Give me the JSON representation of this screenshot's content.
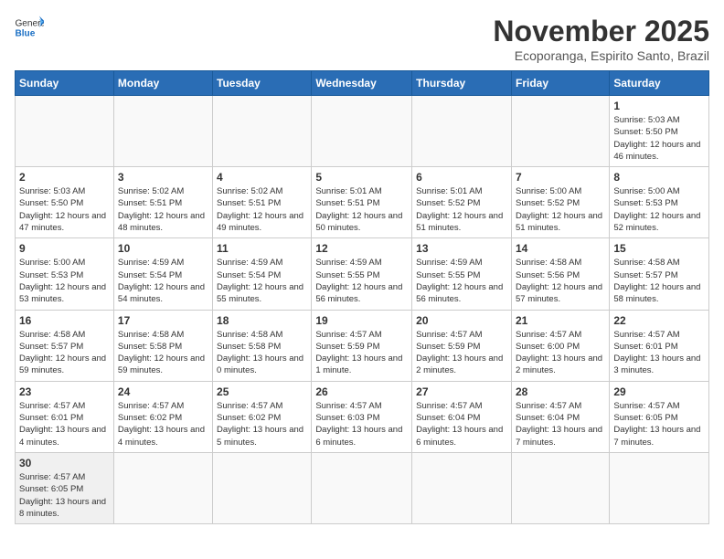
{
  "header": {
    "logo_general": "General",
    "logo_blue": "Blue",
    "month_title": "November 2025",
    "location": "Ecoporanga, Espirito Santo, Brazil"
  },
  "weekdays": [
    "Sunday",
    "Monday",
    "Tuesday",
    "Wednesday",
    "Thursday",
    "Friday",
    "Saturday"
  ],
  "weeks": [
    [
      {
        "day": "",
        "info": ""
      },
      {
        "day": "",
        "info": ""
      },
      {
        "day": "",
        "info": ""
      },
      {
        "day": "",
        "info": ""
      },
      {
        "day": "",
        "info": ""
      },
      {
        "day": "",
        "info": ""
      },
      {
        "day": "1",
        "info": "Sunrise: 5:03 AM\nSunset: 5:50 PM\nDaylight: 12 hours and 46 minutes."
      }
    ],
    [
      {
        "day": "2",
        "info": "Sunrise: 5:03 AM\nSunset: 5:50 PM\nDaylight: 12 hours and 47 minutes."
      },
      {
        "day": "3",
        "info": "Sunrise: 5:02 AM\nSunset: 5:51 PM\nDaylight: 12 hours and 48 minutes."
      },
      {
        "day": "4",
        "info": "Sunrise: 5:02 AM\nSunset: 5:51 PM\nDaylight: 12 hours and 49 minutes."
      },
      {
        "day": "5",
        "info": "Sunrise: 5:01 AM\nSunset: 5:51 PM\nDaylight: 12 hours and 50 minutes."
      },
      {
        "day": "6",
        "info": "Sunrise: 5:01 AM\nSunset: 5:52 PM\nDaylight: 12 hours and 51 minutes."
      },
      {
        "day": "7",
        "info": "Sunrise: 5:00 AM\nSunset: 5:52 PM\nDaylight: 12 hours and 51 minutes."
      },
      {
        "day": "8",
        "info": "Sunrise: 5:00 AM\nSunset: 5:53 PM\nDaylight: 12 hours and 52 minutes."
      }
    ],
    [
      {
        "day": "9",
        "info": "Sunrise: 5:00 AM\nSunset: 5:53 PM\nDaylight: 12 hours and 53 minutes."
      },
      {
        "day": "10",
        "info": "Sunrise: 4:59 AM\nSunset: 5:54 PM\nDaylight: 12 hours and 54 minutes."
      },
      {
        "day": "11",
        "info": "Sunrise: 4:59 AM\nSunset: 5:54 PM\nDaylight: 12 hours and 55 minutes."
      },
      {
        "day": "12",
        "info": "Sunrise: 4:59 AM\nSunset: 5:55 PM\nDaylight: 12 hours and 56 minutes."
      },
      {
        "day": "13",
        "info": "Sunrise: 4:59 AM\nSunset: 5:55 PM\nDaylight: 12 hours and 56 minutes."
      },
      {
        "day": "14",
        "info": "Sunrise: 4:58 AM\nSunset: 5:56 PM\nDaylight: 12 hours and 57 minutes."
      },
      {
        "day": "15",
        "info": "Sunrise: 4:58 AM\nSunset: 5:57 PM\nDaylight: 12 hours and 58 minutes."
      }
    ],
    [
      {
        "day": "16",
        "info": "Sunrise: 4:58 AM\nSunset: 5:57 PM\nDaylight: 12 hours and 59 minutes."
      },
      {
        "day": "17",
        "info": "Sunrise: 4:58 AM\nSunset: 5:58 PM\nDaylight: 12 hours and 59 minutes."
      },
      {
        "day": "18",
        "info": "Sunrise: 4:58 AM\nSunset: 5:58 PM\nDaylight: 13 hours and 0 minutes."
      },
      {
        "day": "19",
        "info": "Sunrise: 4:57 AM\nSunset: 5:59 PM\nDaylight: 13 hours and 1 minute."
      },
      {
        "day": "20",
        "info": "Sunrise: 4:57 AM\nSunset: 5:59 PM\nDaylight: 13 hours and 2 minutes."
      },
      {
        "day": "21",
        "info": "Sunrise: 4:57 AM\nSunset: 6:00 PM\nDaylight: 13 hours and 2 minutes."
      },
      {
        "day": "22",
        "info": "Sunrise: 4:57 AM\nSunset: 6:01 PM\nDaylight: 13 hours and 3 minutes."
      }
    ],
    [
      {
        "day": "23",
        "info": "Sunrise: 4:57 AM\nSunset: 6:01 PM\nDaylight: 13 hours and 4 minutes."
      },
      {
        "day": "24",
        "info": "Sunrise: 4:57 AM\nSunset: 6:02 PM\nDaylight: 13 hours and 4 minutes."
      },
      {
        "day": "25",
        "info": "Sunrise: 4:57 AM\nSunset: 6:02 PM\nDaylight: 13 hours and 5 minutes."
      },
      {
        "day": "26",
        "info": "Sunrise: 4:57 AM\nSunset: 6:03 PM\nDaylight: 13 hours and 6 minutes."
      },
      {
        "day": "27",
        "info": "Sunrise: 4:57 AM\nSunset: 6:04 PM\nDaylight: 13 hours and 6 minutes."
      },
      {
        "day": "28",
        "info": "Sunrise: 4:57 AM\nSunset: 6:04 PM\nDaylight: 13 hours and 7 minutes."
      },
      {
        "day": "29",
        "info": "Sunrise: 4:57 AM\nSunset: 6:05 PM\nDaylight: 13 hours and 7 minutes."
      }
    ],
    [
      {
        "day": "30",
        "info": "Sunrise: 4:57 AM\nSunset: 6:05 PM\nDaylight: 13 hours and 8 minutes."
      },
      {
        "day": "",
        "info": ""
      },
      {
        "day": "",
        "info": ""
      },
      {
        "day": "",
        "info": ""
      },
      {
        "day": "",
        "info": ""
      },
      {
        "day": "",
        "info": ""
      },
      {
        "day": "",
        "info": ""
      }
    ]
  ]
}
